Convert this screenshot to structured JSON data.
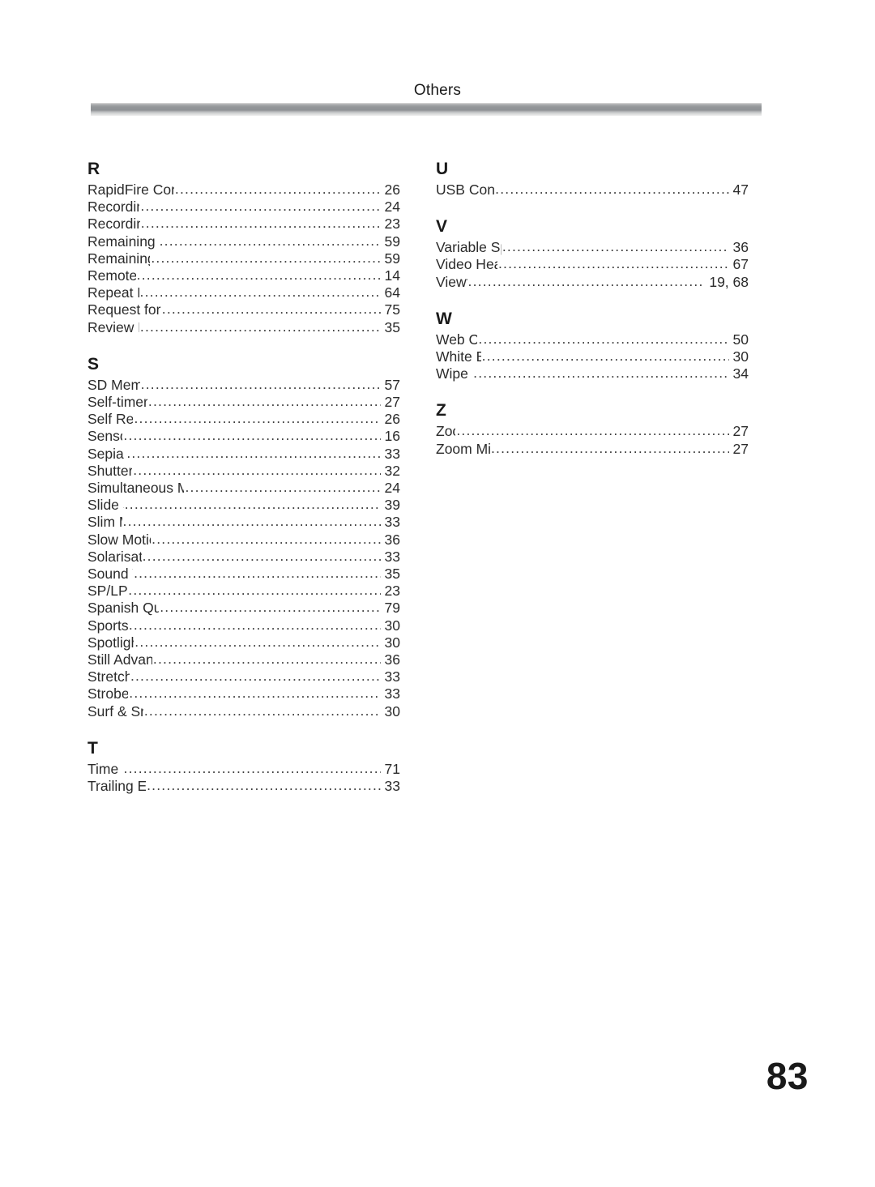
{
  "header": {
    "title": "Others"
  },
  "folio": {
    "page_number": "83"
  },
  "index": {
    "columns": [
      {
        "name": "left",
        "sections": [
          {
            "letter": "R",
            "entries": [
              {
                "title": "RapidFire Consecutive Photoshot",
                "page": "26"
              },
              {
                "title": "Recording Check",
                "page": "24"
              },
              {
                "title": "Recording Speed",
                "page": "23"
              },
              {
                "title": "Remaining Battery Power",
                "page": "59"
              },
              {
                "title": "Remaining Tape Time",
                "page": "59"
              },
              {
                "title": "Remote Control",
                "page": "14"
              },
              {
                "title": "Repeat Playback",
                "page": "64"
              },
              {
                "title": "Request for Service Notice",
                "page": "75"
              },
              {
                "title": "Review Playback",
                "page": "35"
              }
            ]
          },
          {
            "letter": "S",
            "entries": [
              {
                "title": "SD Memory Card",
                "page": "57"
              },
              {
                "title": "Self-timer Recording",
                "page": "27"
              },
              {
                "title": "Self Recording",
                "page": "26"
              },
              {
                "title": "Sensor tag",
                "page": "16"
              },
              {
                "title": "Sepia Mode",
                "page": "33"
              },
              {
                "title": "Shutter Speed",
                "page": "32"
              },
              {
                "title": "Simultaneous Motion/Still Record Mode",
                "page": "24"
              },
              {
                "title": "Slide Show",
                "page": "39"
              },
              {
                "title": "Slim Mode",
                "page": "33"
              },
              {
                "title": "Slow Motion Playback",
                "page": "36"
              },
              {
                "title": "Solarisation Mode",
                "page": "33"
              },
              {
                "title": "Sound Volume",
                "page": "35"
              },
              {
                "title": "SP/LP Mode",
                "page": "23"
              },
              {
                "title": "Spanish Quick Use Guide",
                "page": "79"
              },
              {
                "title": "Sports Mode",
                "page": "30"
              },
              {
                "title": "Spotlight Mode",
                "page": "30"
              },
              {
                "title": "Still Advance Playback",
                "page": "36"
              },
              {
                "title": "Stretch Mode",
                "page": "33"
              },
              {
                "title": "Strobe Mode",
                "page": "33"
              },
              {
                "title": "Surf & Snow Mode",
                "page": "30"
              }
            ]
          },
          {
            "letter": "T",
            "entries": [
              {
                "title": "Time Code",
                "page": "71"
              },
              {
                "title": "Trailing Effect Mode",
                "page": "33"
              }
            ]
          }
        ]
      },
      {
        "name": "right",
        "sections": [
          {
            "letter": "U",
            "entries": [
              {
                "title": "USB Connection Kit",
                "page": "47"
              }
            ]
          },
          {
            "letter": "V",
            "entries": [
              {
                "title": "Variable Speed Search",
                "page": "36"
              },
              {
                "title": "Video Head Clogging",
                "page": "67"
              },
              {
                "title": "Viewfinder",
                "page": "19, 68"
              }
            ]
          },
          {
            "letter": "W",
            "entries": [
              {
                "title": "Web Camera",
                "page": "50"
              },
              {
                "title": "White Balance",
                "page": "30"
              },
              {
                "title": "Wipe Mode",
                "page": "34"
              }
            ]
          },
          {
            "letter": "Z",
            "entries": [
              {
                "title": "Zoom",
                "page": "27"
              },
              {
                "title": "Zoom Microphone",
                "page": "27"
              }
            ]
          }
        ]
      }
    ]
  }
}
